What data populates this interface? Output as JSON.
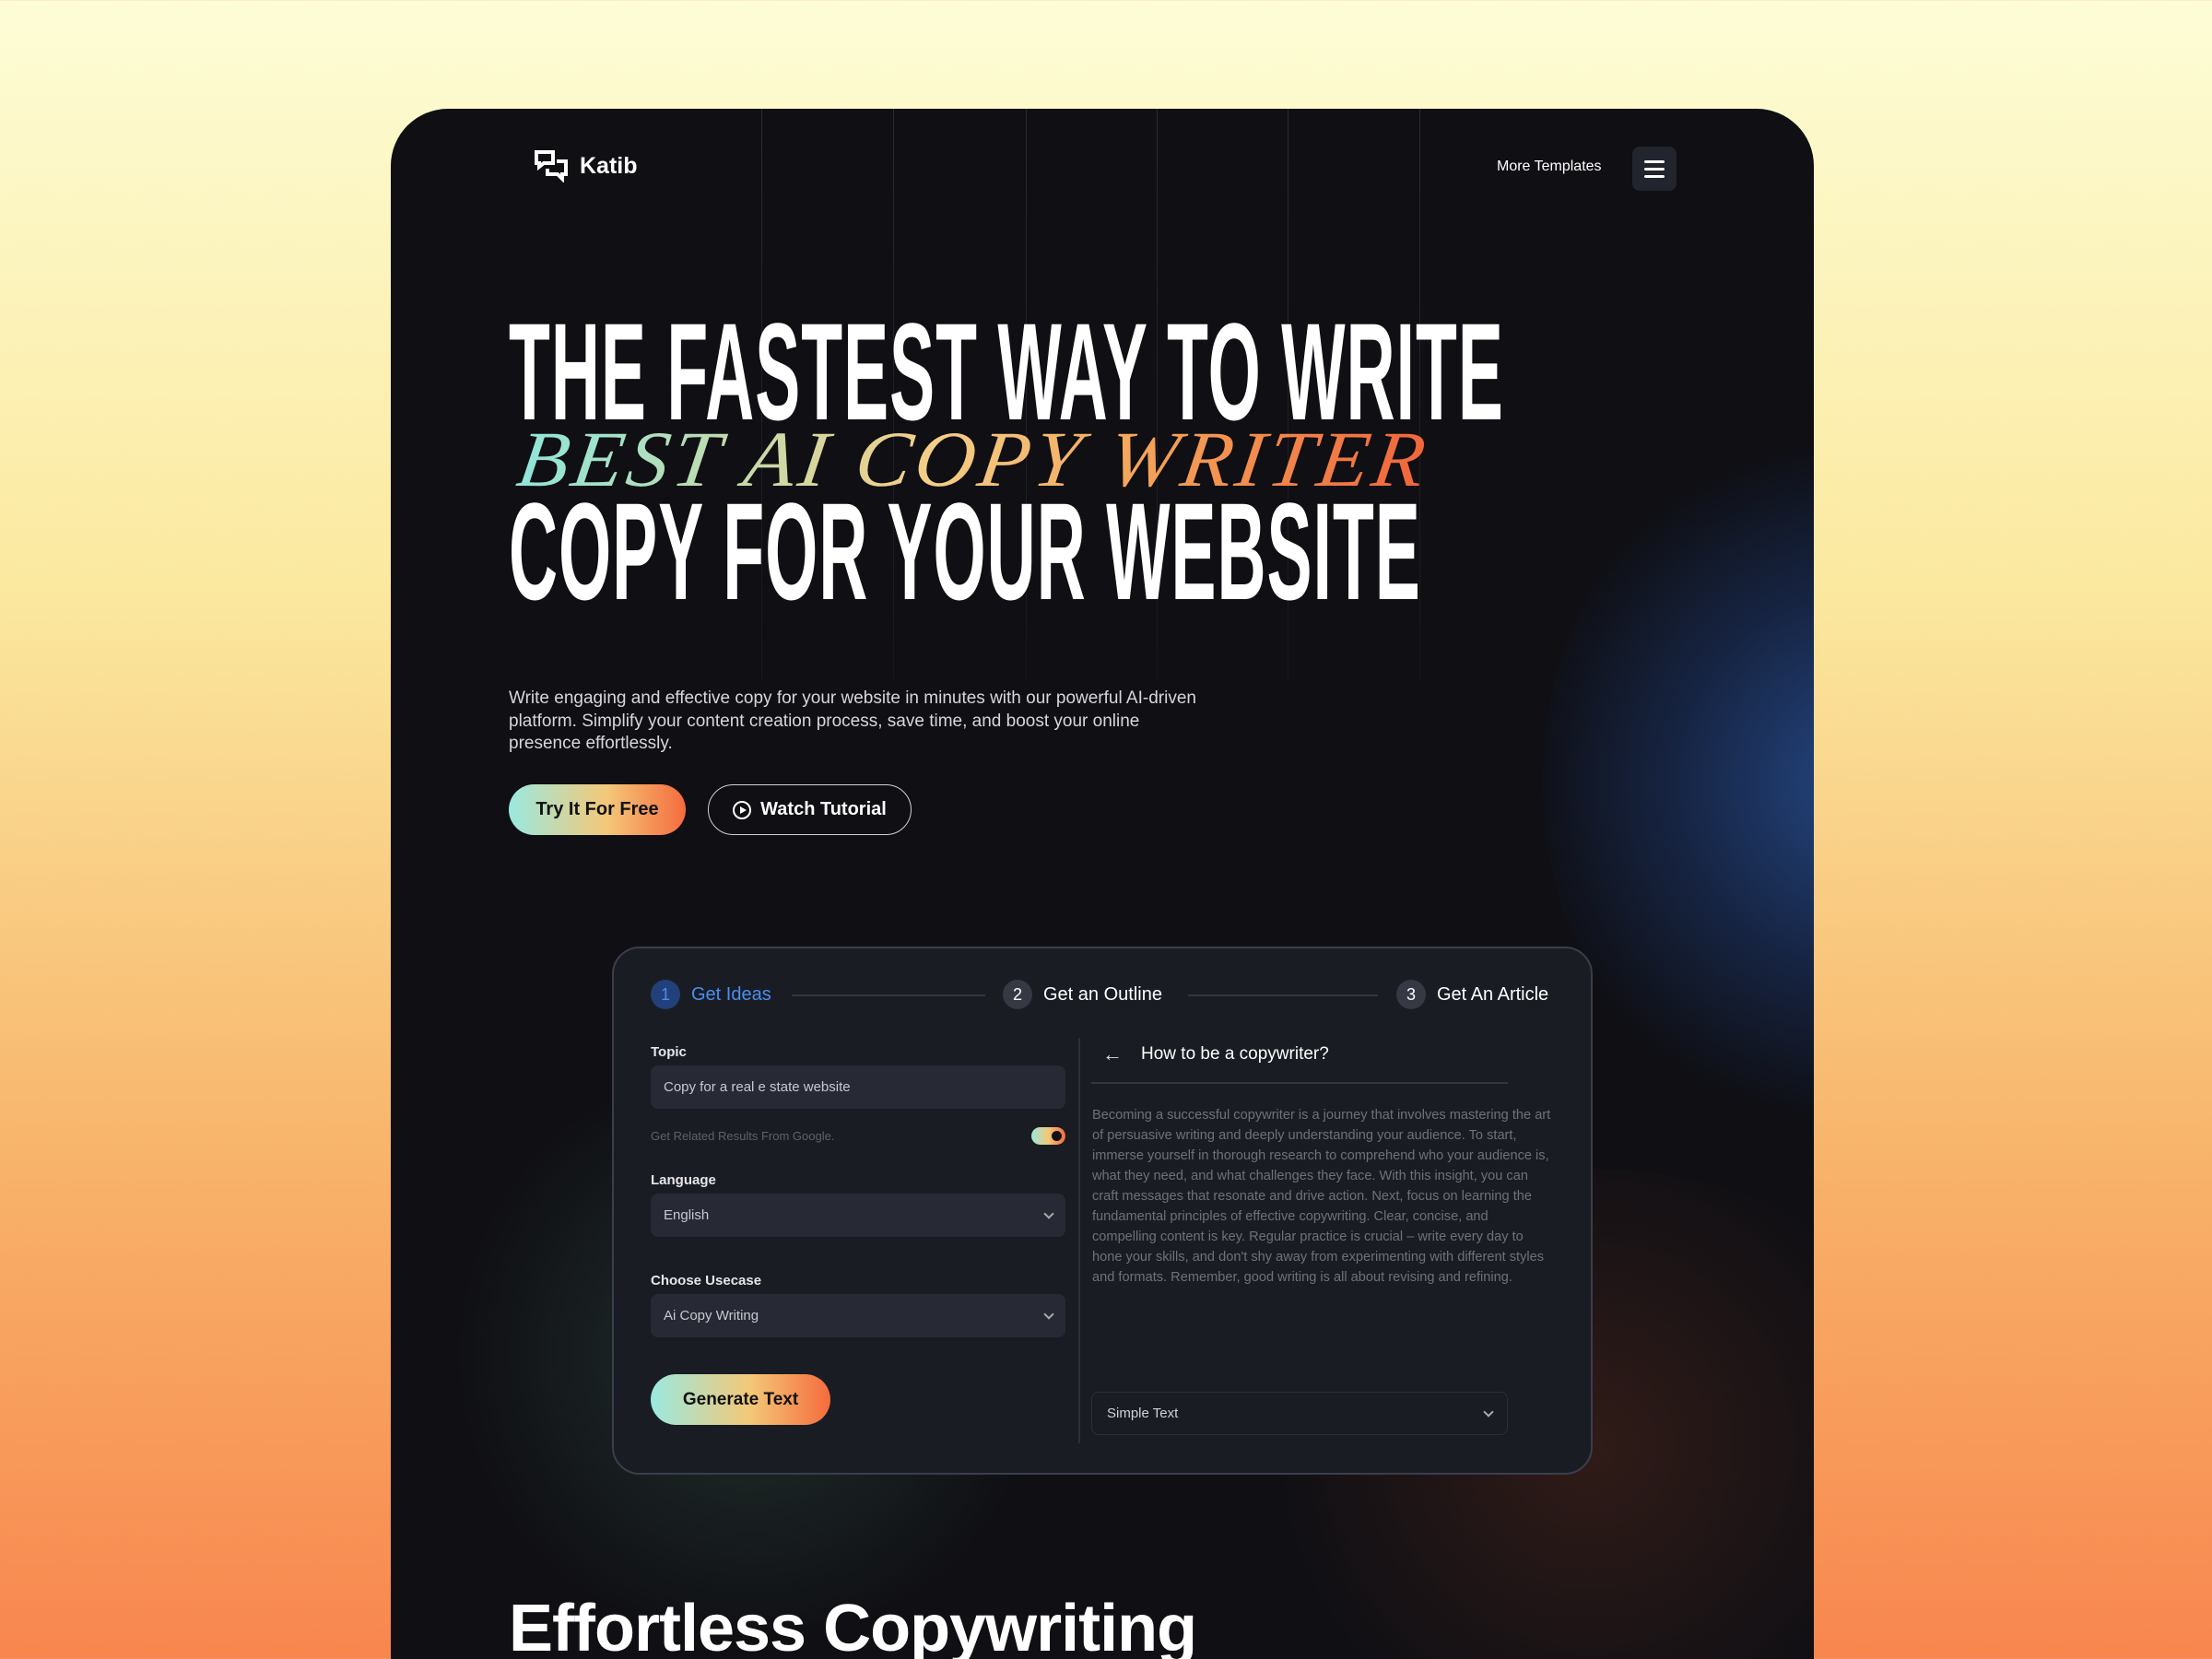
{
  "nav": {
    "brand": "Katib",
    "more_templates": "More Templates",
    "menu_icon": "hamburger-icon"
  },
  "hero": {
    "headline_line1": "THE FASTEST WAY TO WRITE",
    "script_line": "BEST AI COPY WRITER",
    "headline_line2": "COPY FOR YOUR WEBSITE",
    "description": "Write engaging and effective copy for your website in minutes with our powerful AI-driven platform. Simplify your content creation process, save time, and boost your online presence effortlessly.",
    "try_button": "Try It For Free",
    "watch_button": "Watch Tutorial"
  },
  "panel": {
    "steps": [
      {
        "num": "1",
        "label": "Get Ideas",
        "active": true
      },
      {
        "num": "2",
        "label": "Get an Outline"
      },
      {
        "num": "3",
        "label": "Get An Article"
      }
    ],
    "topic_label": "Topic",
    "topic_value": "Copy for a real e state website",
    "google_hint": "Get Related Results From Google.",
    "google_toggle_on": true,
    "language_label": "Language",
    "language_value": "English",
    "usecase_label": "Choose Usecase",
    "usecase_value": "Ai Copy Writing",
    "generate_button": "Generate Text",
    "article_title": "How to be a copywriter?",
    "article_body": "Becoming a successful copywriter is a journey that involves mastering the art of persuasive writing and deeply understanding your audience. To start, immerse yourself in thorough research to comprehend who your audience is, what they need, and what challenges they face. With this insight, you can craft messages that resonate and drive action. Next, focus on learning the fundamental principles of effective copywriting. Clear, concise, and compelling content is key. Regular practice is crucial – write every day to hone your skills, and don't shy away from experimenting with different styles and formats. Remember, good writing is all about revising and refining.",
    "format_value": "Simple Text"
  },
  "section_title": "Effortless Copywriting",
  "colors": {
    "accent_blue": "#4a8ef0",
    "gradient_start": "#9ae9df",
    "gradient_mid": "#f3c879",
    "gradient_end": "#f56b3d",
    "card_bg": "#0f0f14",
    "panel_bg": "#1a1c24"
  }
}
